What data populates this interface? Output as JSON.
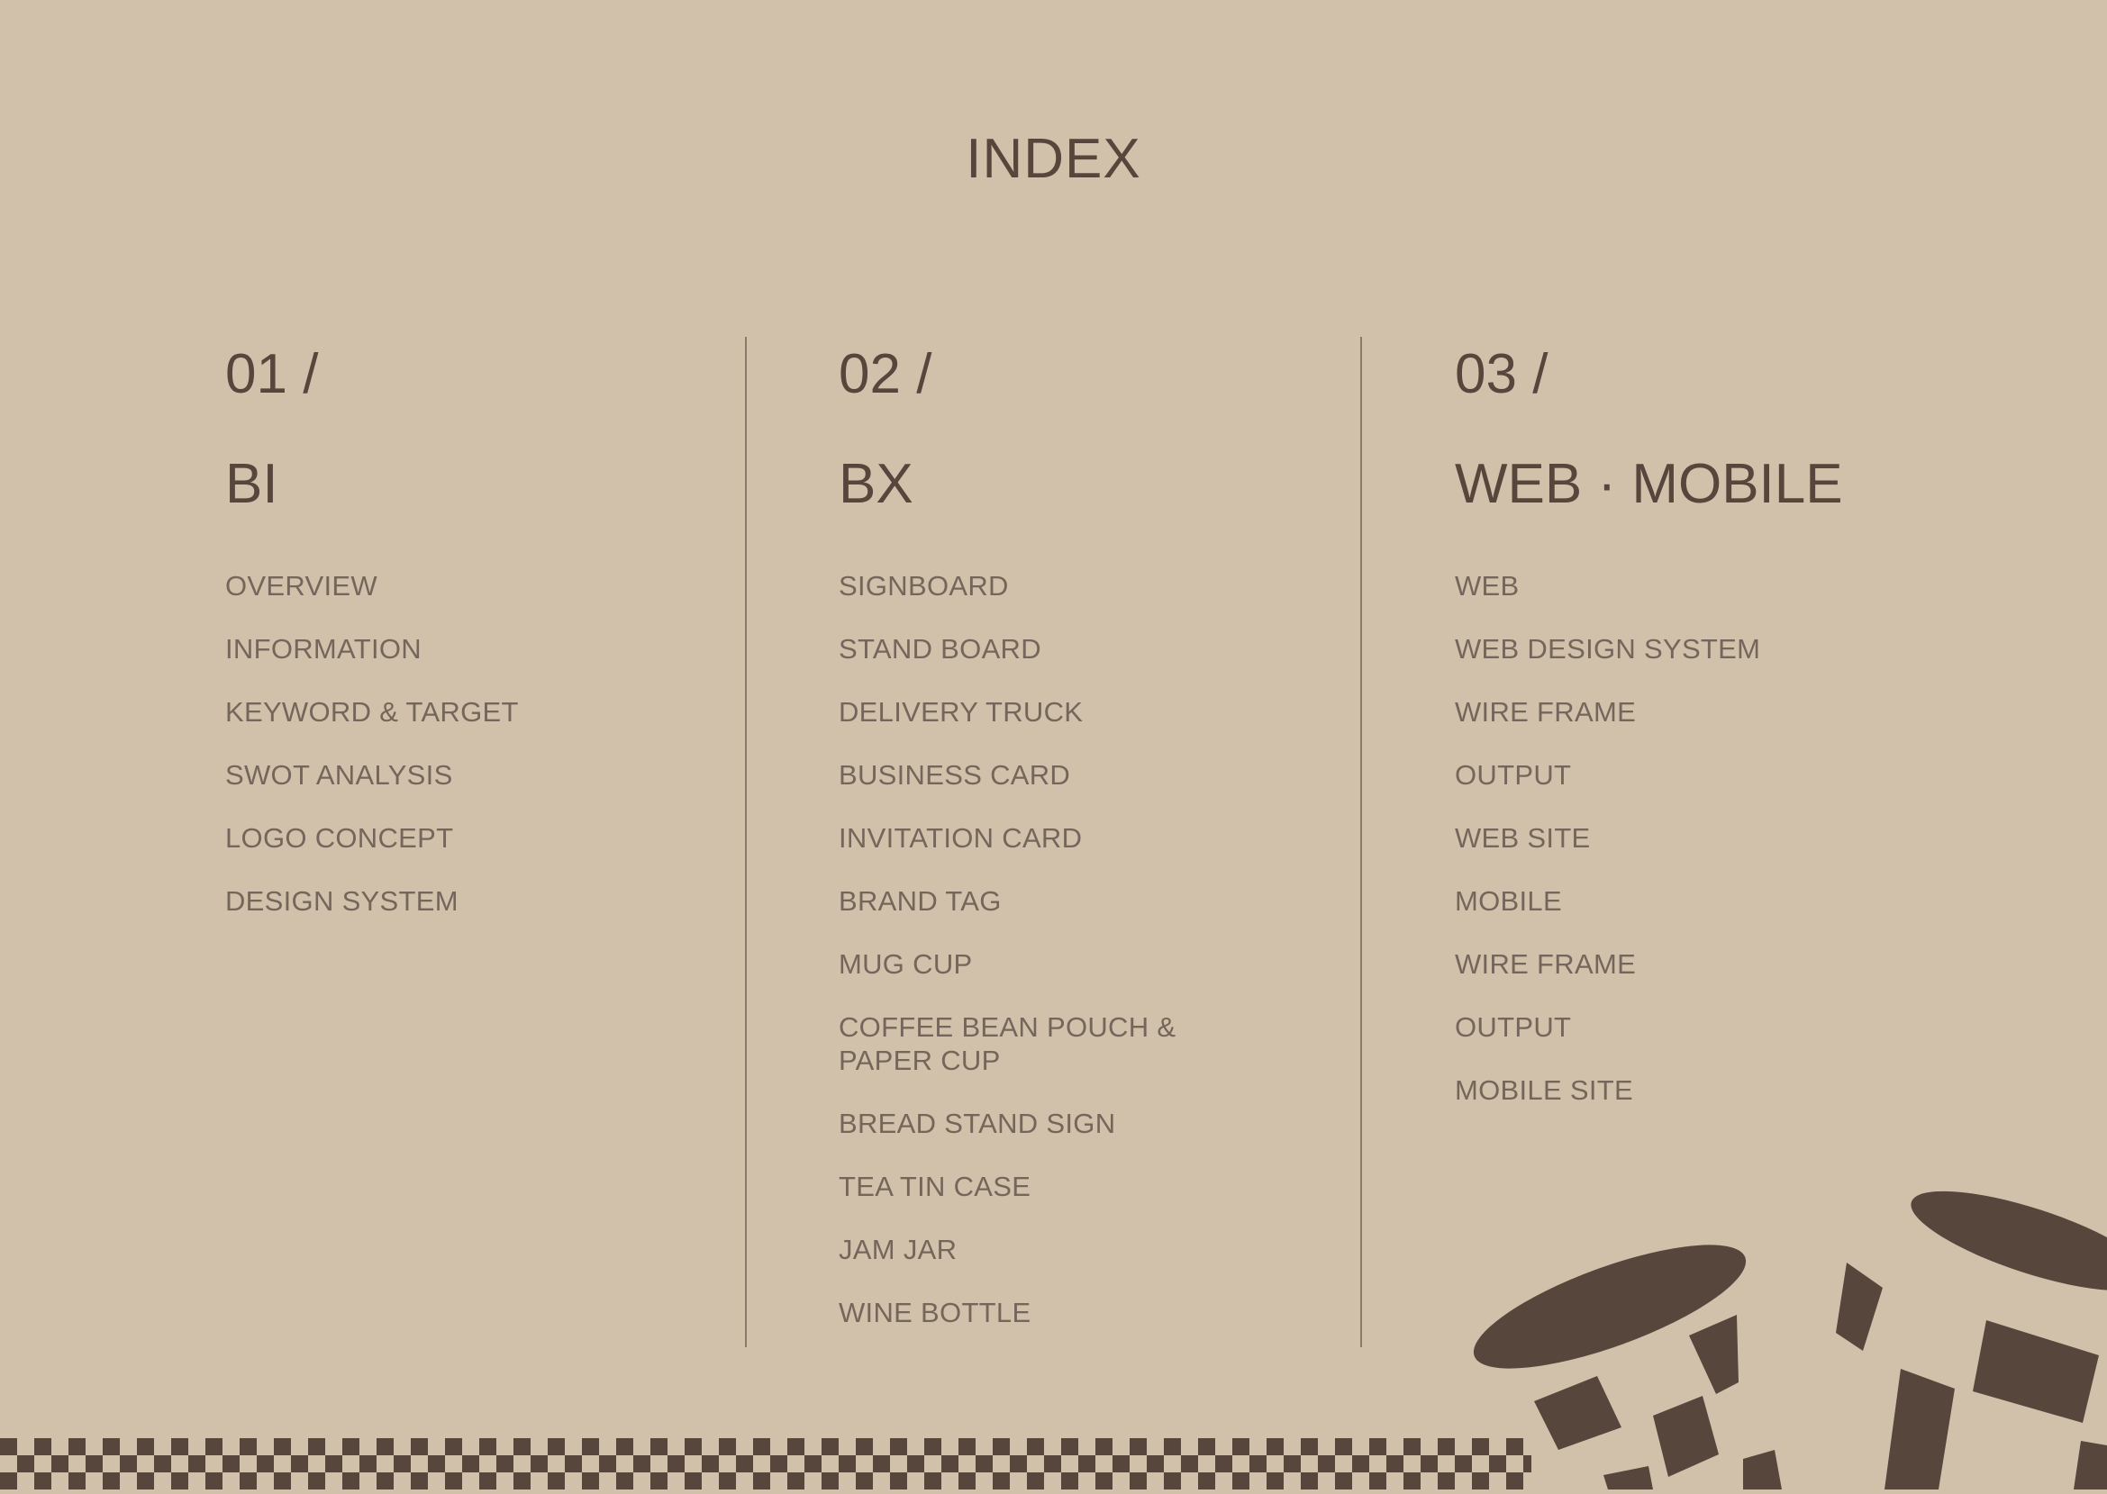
{
  "page": {
    "title": "INDEX"
  },
  "sections": [
    {
      "number": "01 /",
      "title": "BI",
      "items": [
        "OVERVIEW",
        "INFORMATION",
        "KEYWORD & TARGET",
        "SWOT ANALYSIS",
        "LOGO CONCEPT",
        "DESIGN SYSTEM"
      ]
    },
    {
      "number": "02 /",
      "title": "BX",
      "items": [
        "SIGNBOARD",
        "STAND BOARD",
        "DELIVERY TRUCK",
        "BUSINESS CARD",
        "INVITATION CARD",
        "BRAND TAG",
        "MUG CUP",
        "COFFEE BEAN POUCH & PAPER CUP",
        "BREAD STAND SIGN",
        "TEA TIN CASE",
        "JAM JAR",
        "WINE BOTTLE"
      ]
    },
    {
      "number": "03 /",
      "title": "WEB · MOBILE",
      "items": [
        "WEB",
        "WEB DESIGN SYSTEM",
        "WIRE FRAME",
        "OUTPUT",
        "WEB SITE",
        "MOBILE",
        "WIRE FRAME",
        "OUTPUT",
        "MOBILE SITE"
      ]
    }
  ],
  "colors": {
    "background": "#d1c1ab",
    "ink": "#56463c",
    "muted": "#75665b"
  }
}
